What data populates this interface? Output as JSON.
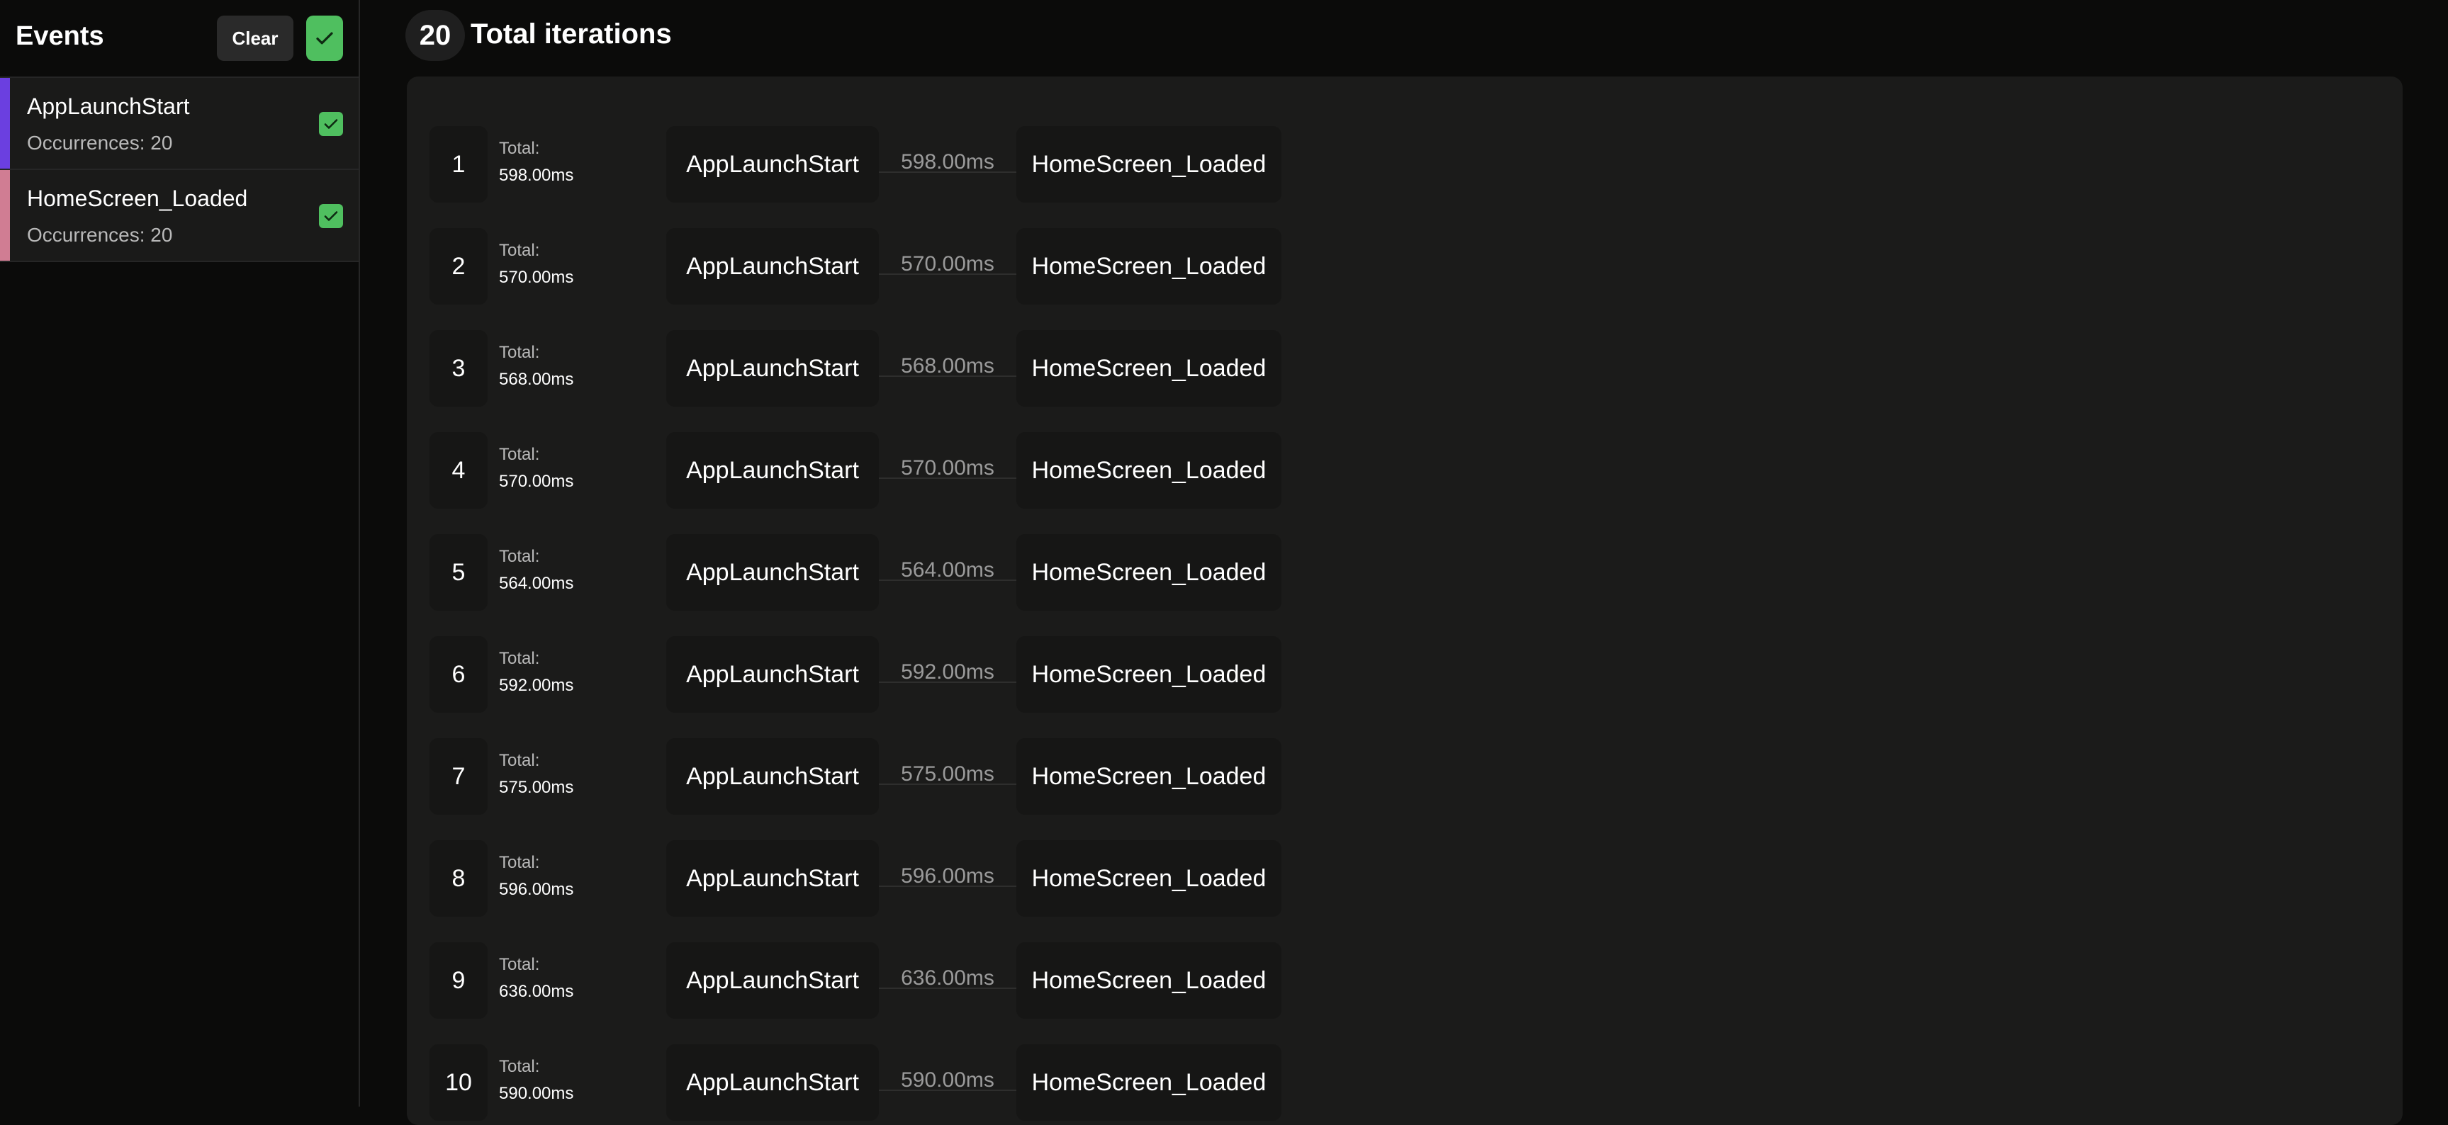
{
  "sidebar": {
    "title": "Events",
    "clear_label": "Clear",
    "select_all_icon": "checkmark-icon",
    "items": [
      {
        "name": "AppLaunchStart",
        "occurrences": "Occurrences: 20",
        "color": "#6b3fe0",
        "checked": true
      },
      {
        "name": "HomeScreen_Loaded",
        "occurrences": "Occurrences: 20",
        "color": "#d07d93",
        "checked": true
      }
    ]
  },
  "header": {
    "count": "20",
    "title": "Total iterations"
  },
  "iterations": {
    "total_label": "Total:",
    "rows": [
      {
        "index": "1",
        "total": "598.00ms",
        "from": "AppLaunchStart",
        "duration": "598.00ms",
        "to": "HomeScreen_Loaded"
      },
      {
        "index": "2",
        "total": "570.00ms",
        "from": "AppLaunchStart",
        "duration": "570.00ms",
        "to": "HomeScreen_Loaded"
      },
      {
        "index": "3",
        "total": "568.00ms",
        "from": "AppLaunchStart",
        "duration": "568.00ms",
        "to": "HomeScreen_Loaded"
      },
      {
        "index": "4",
        "total": "570.00ms",
        "from": "AppLaunchStart",
        "duration": "570.00ms",
        "to": "HomeScreen_Loaded"
      },
      {
        "index": "5",
        "total": "564.00ms",
        "from": "AppLaunchStart",
        "duration": "564.00ms",
        "to": "HomeScreen_Loaded"
      },
      {
        "index": "6",
        "total": "592.00ms",
        "from": "AppLaunchStart",
        "duration": "592.00ms",
        "to": "HomeScreen_Loaded"
      },
      {
        "index": "7",
        "total": "575.00ms",
        "from": "AppLaunchStart",
        "duration": "575.00ms",
        "to": "HomeScreen_Loaded"
      },
      {
        "index": "8",
        "total": "596.00ms",
        "from": "AppLaunchStart",
        "duration": "596.00ms",
        "to": "HomeScreen_Loaded"
      },
      {
        "index": "9",
        "total": "636.00ms",
        "from": "AppLaunchStart",
        "duration": "636.00ms",
        "to": "HomeScreen_Loaded"
      },
      {
        "index": "10",
        "total": "590.00ms",
        "from": "AppLaunchStart",
        "duration": "590.00ms",
        "to": "HomeScreen_Loaded"
      }
    ]
  }
}
